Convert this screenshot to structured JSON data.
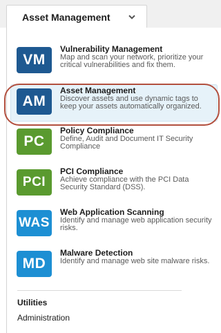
{
  "header": {
    "current_module": "Asset Management",
    "dropdown_icon": "chevron-down-icon"
  },
  "modules": [
    {
      "abbr": "VM",
      "title": "Vulnerability Management",
      "description": "Map and scan your network, prioritize your critical vulnerabilities and fix them.",
      "color": "#1e5991"
    },
    {
      "abbr": "AM",
      "title": "Asset Management",
      "description": "Discover assets and use dynamic tags to keep your assets automatically organized.",
      "color": "#1e5991",
      "selected": true
    },
    {
      "abbr": "PC",
      "title": "Policy Compliance",
      "description": "Define, Audit and Document IT Security Compliance",
      "color": "#5a9a2f"
    },
    {
      "abbr": "PCI",
      "title": "PCI Compliance",
      "description": "Achieve compliance with the PCI Data Security Standard (DSS).",
      "color": "#5a9a2f"
    },
    {
      "abbr": "WAS",
      "title": "Web Application Scanning",
      "description": "Identify and manage web application security risks.",
      "color": "#1d8fd3"
    },
    {
      "abbr": "MD",
      "title": "Malware Detection",
      "description": "Identify and manage web site malware risks.",
      "color": "#1d8fd3"
    }
  ],
  "utilities": {
    "heading": "Utilities",
    "items": [
      {
        "label": "Administration"
      }
    ]
  },
  "highlight_color": "#b24f3e"
}
